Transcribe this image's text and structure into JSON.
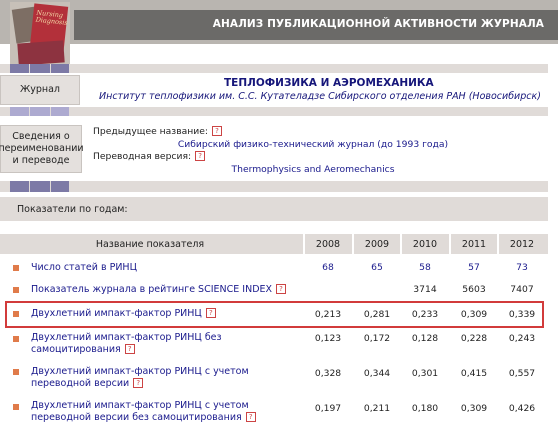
{
  "header": {
    "title": "АНАЛИЗ ПУБЛИКАЦИОННОЙ АКТИВНОСТИ ЖУРНАЛА",
    "logo_text": "Nursing Diagnosis"
  },
  "journal": {
    "label": "Журнал",
    "title": "ТЕПЛОФИЗИКА И АЭРОМЕХАНИКА",
    "institution": "Институт теплофизики им. С.С. Кутателадзе Сибирского отделения РАН (Новосибирск)"
  },
  "renaming": {
    "label_line1": "Сведения о",
    "label_line2": "переименовании",
    "label_line3": "и переводе",
    "prev_name_label": "Предыдущее название:",
    "prev_name_value": "Сибирский физико-технический журнал (до 1993 года)",
    "translation_label": "Переводная версия:",
    "translation_value": "Thermophysics and Aeromechanics",
    "help_glyph": "?"
  },
  "by_years": {
    "title": "Показатели по годам:"
  },
  "table": {
    "name_header": "Название показателя",
    "years": [
      "2008",
      "2009",
      "2010",
      "2011",
      "2012"
    ],
    "rows": [
      {
        "line1": "Число статей в РИНЦ",
        "line2": "",
        "values": [
          "68",
          "65",
          "58",
          "57",
          "73"
        ],
        "help": false
      },
      {
        "line1": "Показатель журнала в рейтинге SCIENCE INDEX",
        "line2": "",
        "values": [
          "",
          "",
          "3714",
          "5603",
          "7407"
        ],
        "help": true
      },
      {
        "line1": "Двухлетний импакт-фактор РИНЦ",
        "line2": "",
        "values": [
          "0,213",
          "0,281",
          "0,233",
          "0,309",
          "0,339"
        ],
        "help": true
      },
      {
        "line1": "Двухлетний импакт-фактор РИНЦ без",
        "line2": "самоцитирования",
        "values": [
          "0,123",
          "0,172",
          "0,128",
          "0,228",
          "0,243"
        ],
        "help": true
      },
      {
        "line1": "Двухлетний импакт-фактор РИНЦ с учетом",
        "line2": "переводной версии",
        "values": [
          "0,328",
          "0,344",
          "0,301",
          "0,415",
          "0,557"
        ],
        "help": true
      },
      {
        "line1": "Двухлетний импакт-фактор РИНЦ с учетом",
        "line2": "переводной версии без самоцитирования",
        "values": [
          "0,197",
          "0,211",
          "0,180",
          "0,309",
          "0,426"
        ],
        "help": true
      }
    ]
  }
}
